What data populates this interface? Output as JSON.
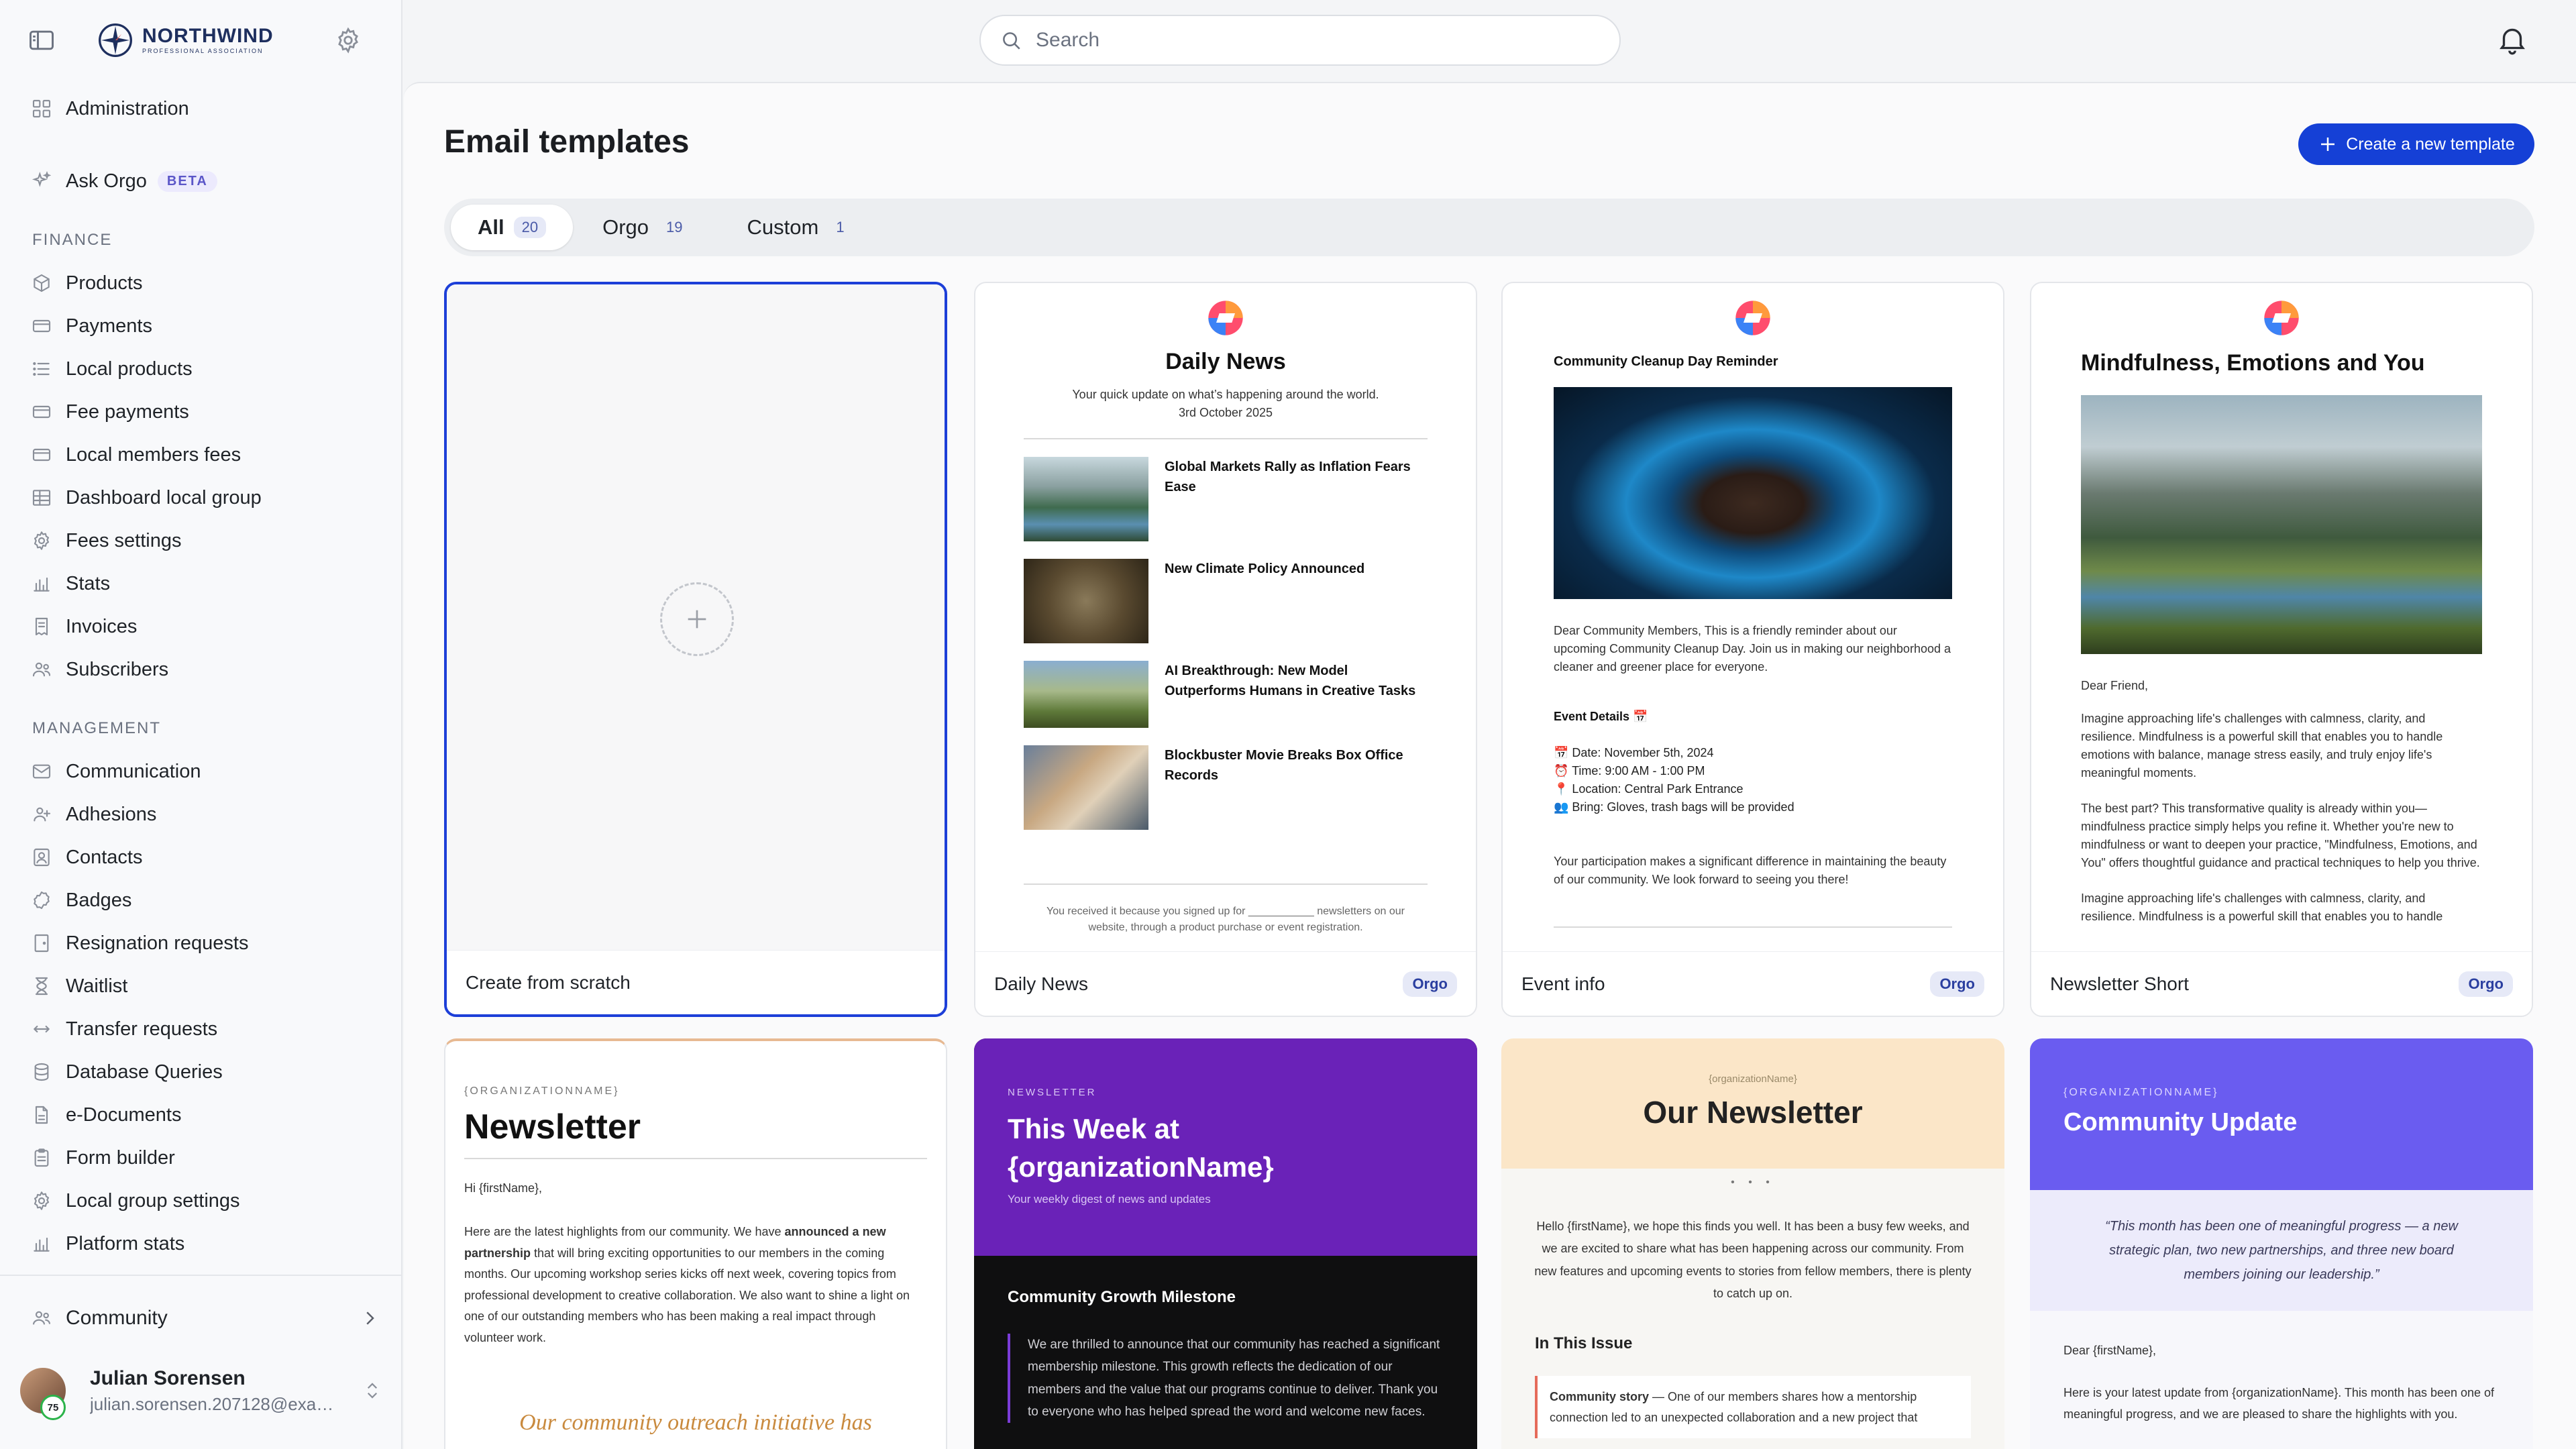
{
  "brand": {
    "name": "NORTHWIND",
    "tagline": "PROFESSIONAL ASSOCIATION"
  },
  "sidebar": {
    "admin": {
      "label": "Administration",
      "icon": "grid-icon"
    },
    "ask": {
      "label": "Ask Orgo",
      "badge": "BETA",
      "icon": "sparkle-icon"
    },
    "finance_heading": "FINANCE",
    "finance": [
      {
        "label": "Products",
        "icon": "box-icon"
      },
      {
        "label": "Payments",
        "icon": "card-icon"
      },
      {
        "label": "Local products",
        "icon": "list-icon"
      },
      {
        "label": "Fee payments",
        "icon": "card-icon"
      },
      {
        "label": "Local members fees",
        "icon": "card-icon"
      },
      {
        "label": "Dashboard local group",
        "icon": "table-icon"
      },
      {
        "label": "Fees settings",
        "icon": "gear-icon"
      },
      {
        "label": "Stats",
        "icon": "chart-icon"
      },
      {
        "label": "Invoices",
        "icon": "receipt-icon"
      },
      {
        "label": "Subscribers",
        "icon": "users-icon"
      }
    ],
    "management_heading": "MANAGEMENT",
    "management": [
      {
        "label": "Communication",
        "icon": "mail-icon"
      },
      {
        "label": "Adhesions",
        "icon": "user-plus-icon"
      },
      {
        "label": "Contacts",
        "icon": "contact-icon"
      },
      {
        "label": "Badges",
        "icon": "badge-icon"
      },
      {
        "label": "Resignation requests",
        "icon": "door-icon"
      },
      {
        "label": "Waitlist",
        "icon": "hourglass-icon"
      },
      {
        "label": "Transfer requests",
        "icon": "arrows-icon"
      },
      {
        "label": "Database Queries",
        "icon": "database-icon"
      },
      {
        "label": "e-Documents",
        "icon": "document-icon"
      },
      {
        "label": "Form builder",
        "icon": "clipboard-icon"
      },
      {
        "label": "Local group settings",
        "icon": "gear-icon"
      },
      {
        "label": "Platform stats",
        "icon": "chart-icon"
      }
    ],
    "community": "Community",
    "user": {
      "name": "Julian Sorensen",
      "email": "julian.sorensen.207128@example....",
      "level": "75"
    }
  },
  "search": {
    "placeholder": "Search"
  },
  "page": {
    "title": "Email templates",
    "create_button": "Create a new template",
    "tabs": [
      {
        "label": "All",
        "count": "20"
      },
      {
        "label": "Orgo",
        "count": "19"
      },
      {
        "label": "Custom",
        "count": "1"
      }
    ]
  },
  "cards": [
    {
      "name": "Create from scratch"
    },
    {
      "name": "Daily News",
      "tag": "Orgo",
      "preview": {
        "title": "Daily News",
        "sub1": "Your quick update on what’s happening around the world.",
        "sub2": "3rd October 2025",
        "items": [
          "Global Markets Rally as Inflation Fears Ease",
          "New Climate Policy Announced",
          "AI Breakthrough: New Model Outperforms Humans in Creative Tasks",
          "Blockbuster Movie Breaks Box Office Records"
        ],
        "footer": "You received it because you signed up for ___________ newsletters on our website, through a product purchase or event registration."
      }
    },
    {
      "name": "Event info",
      "tag": "Orgo",
      "preview": {
        "title": "Community Cleanup Day Reminder",
        "body": "Dear Community Members, This is a friendly reminder about our upcoming Community Cleanup Day. Join us in making our neighborhood a cleaner and greener place for everyone.",
        "details_title": "Event Details 📅",
        "details": [
          "📅 Date: November 5th, 2024",
          "⏰ Time: 9:00 AM - 1:00 PM",
          "📍 Location: Central Park Entrance",
          "👥 Bring: Gloves, trash bags will be provided"
        ],
        "closing": "Your participation makes a significant difference in maintaining the beauty of our community. We look forward to seeing you there!"
      }
    },
    {
      "name": "Newsletter Short",
      "tag": "Orgo",
      "preview": {
        "title": "Mindfulness, Emotions and You",
        "greeting": "Dear Friend,",
        "p1": "Imagine approaching life's challenges with calmness, clarity, and resilience. Mindfulness is a powerful skill that enables you to handle emotions with balance, manage stress easily, and truly enjoy life's meaningful moments.",
        "p2": "The best part? This transformative quality is already within you—mindfulness practice simply helps you refine it. Whether you're new to mindfulness or want to deepen your practice, \"Mindfulness, Emotions, and You\" offers thoughtful guidance and practical techniques to help you thrive.",
        "p3": "Imagine approaching life's challenges with calmness, clarity, and resilience. Mindfulness is a powerful skill that enables you to handle"
      }
    },
    {
      "preview": {
        "org": "{ORGANIZATIONNAME}",
        "title": "Newsletter",
        "greeting": "Hi {firstName},",
        "p1a": "Here are the latest highlights from our community. We have ",
        "p1b": "announced a new partnership",
        "p1c": " that will bring exciting opportunities to our members in the coming months. Our upcoming workshop series kicks off next week, covering topics from professional development to creative collaboration. We also want to shine a light on one of our outstanding members who has been making a real impact through volunteer work.",
        "quote": "Our community outreach initiative has"
      }
    },
    {
      "preview": {
        "kicker": "NEWSLETTER",
        "title": "This Week at {organizationName}",
        "sub": "Your weekly digest of news and updates",
        "section": "Community Growth Milestone",
        "body": "We are thrilled to announce that our community has reached a significant membership milestone. This growth reflects the dedication of our members and the value that our programs continue to deliver. Thank you to everyone who has helped spread the word and welcome new faces."
      }
    },
    {
      "preview": {
        "org": "{organizationName}",
        "title": "Our Newsletter",
        "dots": "• • •",
        "body": "Hello {firstName}, we hope this finds you well. It has been a busy few weeks, and we are excited to share what has been happening across our community. From new features and upcoming events to stories from fellow members, there is plenty to catch up on.",
        "section": "In This Issue",
        "story_b": "Community story",
        "story": " — One of our members shares how a mentorship connection led to an unexpected collaboration and a new project that"
      }
    },
    {
      "preview": {
        "org": "{ORGANIZATIONNAME}",
        "title": "Community Update",
        "quote": "“This month has been one of meaningful progress — a new strategic plan, two new partnerships, and three new board members joining our leadership.”",
        "greeting": "Dear {firstName},",
        "body": "Here is your latest update from {organizationName}. This month has been one of meaningful progress, and we are pleased to share the highlights with you."
      }
    }
  ]
}
